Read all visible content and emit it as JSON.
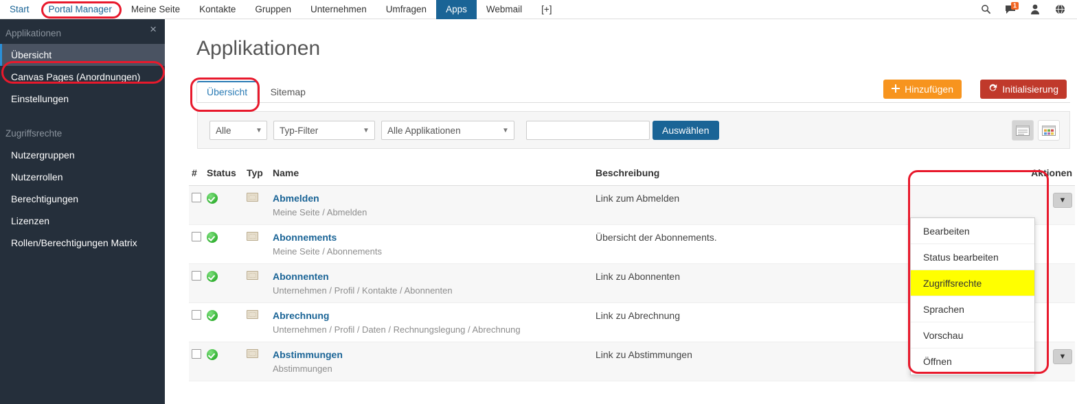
{
  "topnav": {
    "items": [
      {
        "label": "Start",
        "state": "normal"
      },
      {
        "label": "Portal Manager",
        "state": "highlighted"
      },
      {
        "label": "Meine Seite",
        "state": "normal"
      },
      {
        "label": "Kontakte",
        "state": "normal"
      },
      {
        "label": "Gruppen",
        "state": "normal"
      },
      {
        "label": "Unternehmen",
        "state": "normal"
      },
      {
        "label": "Umfragen",
        "state": "normal"
      },
      {
        "label": "Apps",
        "state": "active"
      },
      {
        "label": "Webmail",
        "state": "normal"
      },
      {
        "label": "[+]",
        "state": "normal"
      }
    ],
    "icons": {
      "search": "search-icon",
      "messages": "chat-icon",
      "messages_badge": "1",
      "user": "user-icon",
      "globe": "globe-icon"
    }
  },
  "sidebar": {
    "close_label": "×",
    "groups": [
      {
        "title": "Applikationen",
        "items": [
          {
            "label": "Übersicht",
            "active": true
          },
          {
            "label": "Canvas Pages (Anordnungen)",
            "active": false
          },
          {
            "label": "Einstellungen",
            "active": false
          }
        ]
      },
      {
        "title": "Zugriffsrechte",
        "items": [
          {
            "label": "Nutzergruppen",
            "active": false
          },
          {
            "label": "Nutzerrollen",
            "active": false
          },
          {
            "label": "Berechtigungen",
            "active": false
          },
          {
            "label": "Lizenzen",
            "active": false
          },
          {
            "label": "Rollen/Berechtigungen Matrix",
            "active": false
          }
        ]
      }
    ]
  },
  "main": {
    "title": "Applikationen",
    "tabs": [
      {
        "label": "Übersicht",
        "active": true
      },
      {
        "label": "Sitemap",
        "active": false
      }
    ],
    "buttons": {
      "add": {
        "label": "Hinzufügen",
        "icon": "plus-icon",
        "color": "#f7941e"
      },
      "init": {
        "label": "Initialisierung",
        "icon": "refresh-icon",
        "color": "#c0392b"
      }
    },
    "filter": {
      "scope_select": {
        "value": "Alle",
        "options": [
          "Alle"
        ]
      },
      "type_select": {
        "value": "Typ-Filter",
        "options": [
          "Typ-Filter"
        ]
      },
      "app_select": {
        "value": "Alle Applikationen",
        "options": [
          "Alle Applikationen"
        ]
      },
      "search_input": {
        "value": "",
        "placeholder": ""
      },
      "select_button": "Auswählen",
      "view_list_icon": "list-view-icon",
      "view_grid_icon": "grid-view-icon"
    },
    "table": {
      "headers": [
        "#",
        "Status",
        "Typ",
        "Name",
        "Beschreibung",
        "Aktionen"
      ],
      "rows": [
        {
          "checked": false,
          "status": "active",
          "type_icon": "window-icon",
          "name": "Abmelden",
          "path": "Meine Seite / Abmelden",
          "description": "Link zum Abmelden",
          "action_caret": "chevron-down-icon"
        },
        {
          "checked": false,
          "status": "active",
          "type_icon": "window-icon",
          "name": "Abonnements",
          "path": "Meine Seite / Abonnements",
          "description": "Übersicht der Abonnements.",
          "action_caret": "chevron-down-icon"
        },
        {
          "checked": false,
          "status": "active",
          "type_icon": "window-icon",
          "name": "Abonnenten",
          "path": "Unternehmen / Profil / Kontakte / Abonnenten",
          "description": "Link zu Abonnenten",
          "action_caret": "chevron-down-icon"
        },
        {
          "checked": false,
          "status": "active",
          "type_icon": "window-icon",
          "name": "Abrechnung",
          "path": "Unternehmen / Profil / Daten / Rechnungslegung / Abrechnung",
          "description": "Link zu Abrechnung",
          "action_caret": "chevron-down-icon"
        },
        {
          "checked": false,
          "status": "active",
          "type_icon": "window-icon",
          "name": "Abstimmungen",
          "path": "Abstimmungen",
          "description": "Link zu Abstimmungen",
          "action_caret": "chevron-down-icon"
        }
      ]
    },
    "action_menu": {
      "items": [
        {
          "label": "Bearbeiten",
          "highlighted": false
        },
        {
          "label": "Status bearbeiten",
          "highlighted": false
        },
        {
          "label": "Zugriffsrechte",
          "highlighted": true
        },
        {
          "label": "Sprachen",
          "highlighted": false
        },
        {
          "label": "Vorschau",
          "highlighted": false
        },
        {
          "label": "Öffnen",
          "highlighted": false
        }
      ]
    }
  },
  "annotations": {
    "color": "#e8192c",
    "regions": [
      "portal-manager-nav",
      "sidebar-uebersicht",
      "tab-uebersicht",
      "actions-column"
    ]
  }
}
